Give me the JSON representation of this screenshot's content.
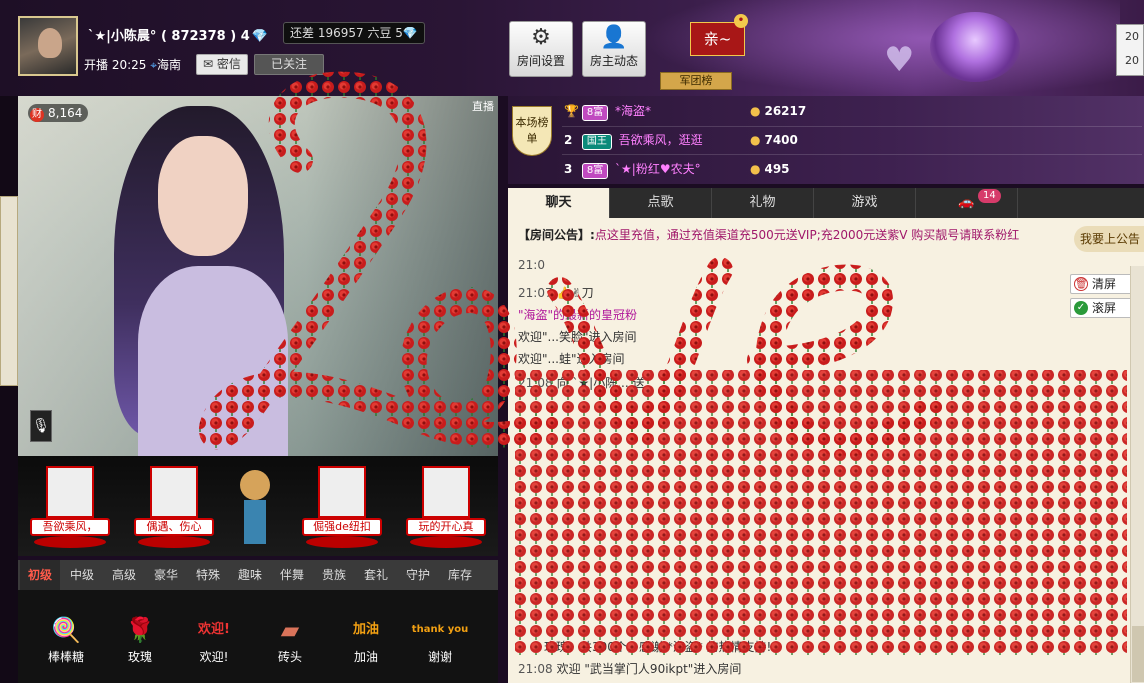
{
  "host": {
    "name": "`★|小陈晨°",
    "id": "( 872378 )",
    "level_box": "还差 196957 六豆 5",
    "level_badge": "4",
    "broadcast": "开播 20:25",
    "location": "海南",
    "msg_btn": "密信",
    "follow_btn": "已关注"
  },
  "toolbar": {
    "room_settings": "房间设置",
    "host_updates": "房主动态",
    "qin_label": "亲~",
    "qin_badge": "•",
    "junbang": "军团榜",
    "date_top": "20",
    "date_bottom": "20"
  },
  "video": {
    "wealth": "8,164",
    "wealth_icon": "财",
    "corner_label": "直播"
  },
  "fans": [
    {
      "name": "吾欲乘风，"
    },
    {
      "name": "偶遇、伤心"
    },
    {
      "name": "倔强de纽扣"
    },
    {
      "name": "玩的开心真"
    }
  ],
  "gift_tabs": [
    "初级",
    "中级",
    "高级",
    "豪华",
    "特殊",
    "趣味",
    "伴舞",
    "贵族",
    "套礼",
    "守护",
    "库存"
  ],
  "gifts": [
    {
      "name": "棒棒糖",
      "icon": "lollipop-icon",
      "glyph": "🍭"
    },
    {
      "name": "玫瑰",
      "icon": "rose-icon",
      "glyph": "🌹"
    },
    {
      "name": "欢迎!",
      "icon": "welcome-icon",
      "glyph": "欢迎!"
    },
    {
      "name": "砖头",
      "icon": "brick-icon",
      "glyph": "▰"
    },
    {
      "name": "加油",
      "icon": "cheer-icon",
      "glyph": "加油"
    },
    {
      "name": "谢谢",
      "icon": "thanks-icon",
      "glyph": "thank you"
    }
  ],
  "rank": {
    "tag": "本场榜单",
    "rows": [
      {
        "no": "",
        "badge": "8富",
        "name": "*海盗*",
        "value": "26217"
      },
      {
        "no": "2",
        "badge": "国王",
        "name": "吾欲乘风，逛逛",
        "value": "7400"
      },
      {
        "no": "3",
        "badge": "8富",
        "name": "`★|粉红♥农夫°",
        "value": "495"
      }
    ]
  },
  "chat_tabs": [
    "聊天",
    "点歌",
    "礼物",
    "游戏"
  ],
  "chat_tab_badge": "14",
  "chat": {
    "notice_key": "【房间公告】:",
    "notice_value": "点这里充值，通过充值渠道充500元送VIP;充2000元送紫V 购买靓号请联系粉红",
    "ad_btn": "我要上公告",
    "clear_btn": "清屏",
    "scroll_btn": "滚屏",
    "messages": [
      {
        "ts": "21:0",
        "text": ""
      },
      {
        "ts": "21:07",
        "text": "👍✌刀"
      },
      {
        "ts": "",
        "text": "\"海盗\"的最新的皇冠粉"
      },
      {
        "ts": "",
        "text": "欢迎\"...笑脸\"进入房间"
      },
      {
        "ts": "",
        "text": "欢迎\"...蛙\"进入房间"
      },
      {
        "ts": "21:08",
        "text": "向 `★|小陈... 送"
      }
    ],
    "gift_line": "玫瑰，共300个，感谢 *海盗* 的热情支持!",
    "last_ts": "21:08",
    "last_text": "欢迎 \"武当掌门人90ikpt\"进入房间"
  },
  "overlay_text": "Love"
}
